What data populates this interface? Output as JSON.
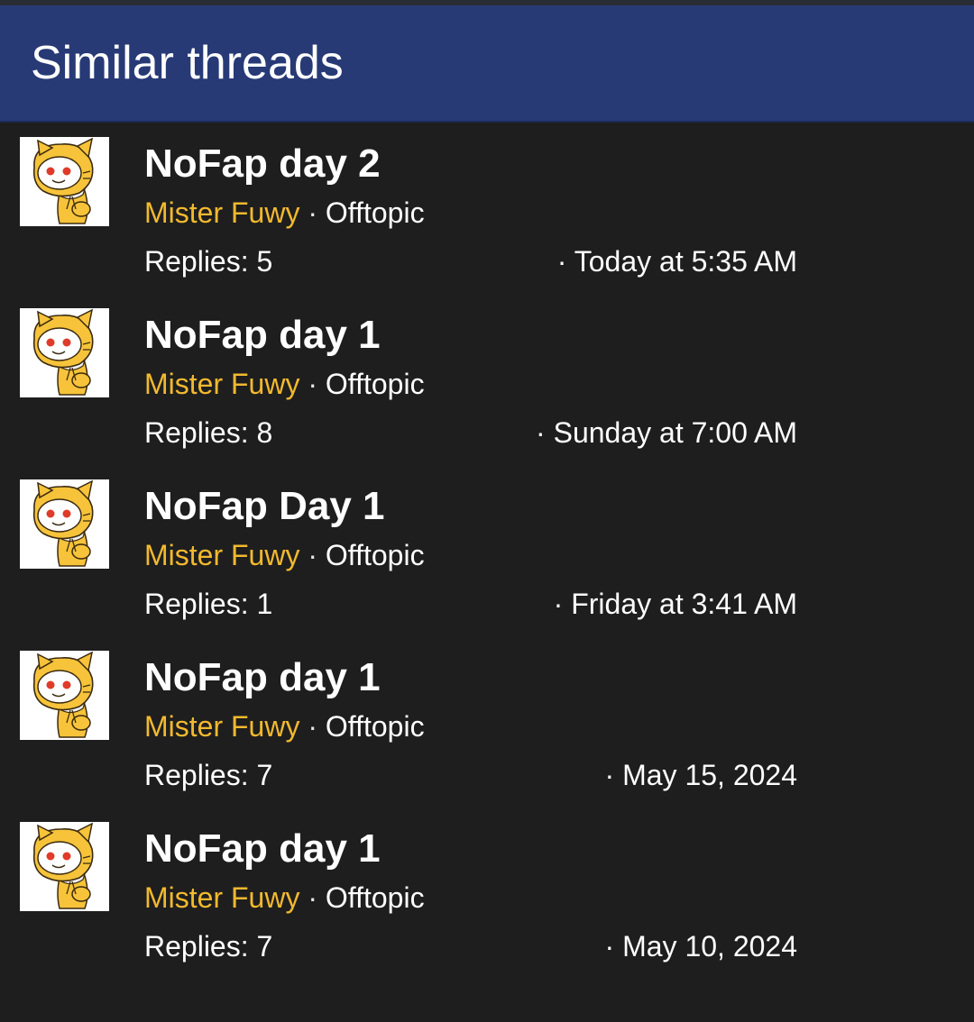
{
  "header": {
    "title": "Similar threads"
  },
  "colors": {
    "header_bg": "#273a76",
    "author": "#f2b92e",
    "page_bg": "#1e1e1e"
  },
  "threads": [
    {
      "avatar_icon": "shiba-snoo-avatar-icon",
      "title": "NoFap day 2",
      "author": "Mister Fuwy",
      "separator": " · ",
      "forum": "Offtopic",
      "replies": "Replies: 5",
      "date": "· Today at 5:35 AM"
    },
    {
      "avatar_icon": "shiba-snoo-avatar-icon",
      "title": "NoFap day 1",
      "author": "Mister Fuwy",
      "separator": " · ",
      "forum": "Offtopic",
      "replies": "Replies: 8",
      "date": "· Sunday at 7:00 AM"
    },
    {
      "avatar_icon": "shiba-snoo-avatar-icon",
      "title": "NoFap Day 1",
      "author": "Mister Fuwy",
      "separator": " · ",
      "forum": "Offtopic",
      "replies": "Replies: 1",
      "date": "· Friday at 3:41 AM"
    },
    {
      "avatar_icon": "shiba-snoo-avatar-icon",
      "title": "NoFap day 1",
      "author": "Mister Fuwy",
      "separator": " · ",
      "forum": "Offtopic",
      "replies": "Replies: 7",
      "date": "· May 15, 2024"
    },
    {
      "avatar_icon": "shiba-snoo-avatar-icon",
      "title": "NoFap day 1",
      "author": "Mister Fuwy",
      "separator": " · ",
      "forum": "Offtopic",
      "replies": "Replies: 7",
      "date": "· May 10, 2024"
    }
  ]
}
